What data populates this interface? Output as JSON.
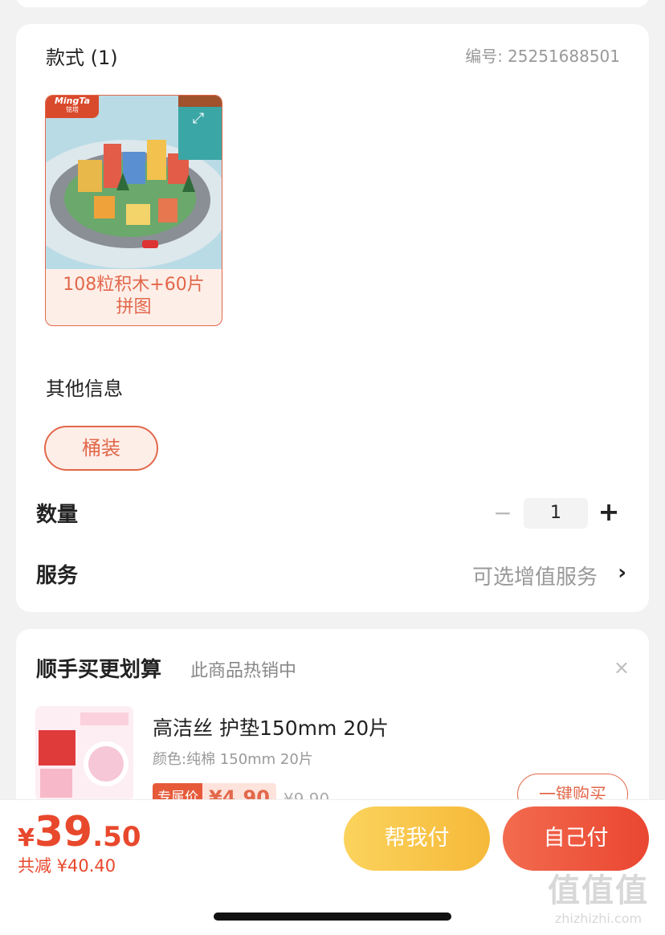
{
  "style_section": {
    "title": "款式 (1)",
    "code_label": "编号:",
    "code_value": "25251688501",
    "option": {
      "brand_badge": "MingTa",
      "brand_badge_sub": "铭塔",
      "label_line1": "108粒积木+60片",
      "label_line2": "拼图"
    }
  },
  "other_info": {
    "title": "其他信息",
    "option_label": "桶装"
  },
  "quantity": {
    "label": "数量",
    "minus": "−",
    "value": "1",
    "plus": "+"
  },
  "service": {
    "label": "服务",
    "value": "可选增值服务",
    "chevron": "›"
  },
  "recommend": {
    "title": "顺手买更划算",
    "subtitle": "此商品热销中",
    "close": "×",
    "product": {
      "title": "高洁丝 护垫150mm 20片",
      "spec": "颜色:纯棉 150mm 20片",
      "tag": "专属价",
      "price": "¥4.90",
      "original_price": "¥9.90",
      "buy_label": "一键购买"
    }
  },
  "bottom_bar": {
    "currency": "¥",
    "price_int": "39",
    "price_dec": ".50",
    "saved": "共减 ¥40.40",
    "help_pay": "帮我付",
    "self_pay": "自己付"
  },
  "watermark": {
    "big": "值值值",
    "small": "zhizhizhi.com"
  },
  "colors": {
    "accent": "#e2684b",
    "price": "#e8482c",
    "help_button": "#f6b93a",
    "self_button": "#ea4631"
  }
}
